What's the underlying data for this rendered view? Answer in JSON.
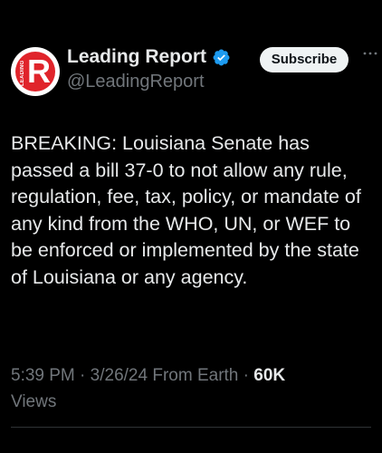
{
  "post": {
    "author": {
      "display_name": "Leading Report",
      "handle": "@LeadingReport",
      "verified": true,
      "avatar_letter": "R",
      "avatar_text": "LEADING",
      "avatar_color": "#e0242b"
    },
    "subscribe_label": "Subscribe",
    "more_icon": "ellipsis-icon",
    "text": "BREAKING: Louisiana Senate has passed a bill 37-0 to not allow any rule, regulation, fee, tax, policy, or mandate of any kind from the WHO, UN, or WEF to be enforced or implemented by the state of Louisiana or any agency.",
    "meta": {
      "time": "5:39 PM",
      "date": "3/26/24",
      "source": "From Earth",
      "views_count": "60K",
      "views_label": "Views",
      "separator": "·"
    },
    "colors": {
      "background": "#000000",
      "text": "#e7e9ea",
      "muted": "#71767b",
      "verified_blue": "#1d9bf0"
    }
  }
}
